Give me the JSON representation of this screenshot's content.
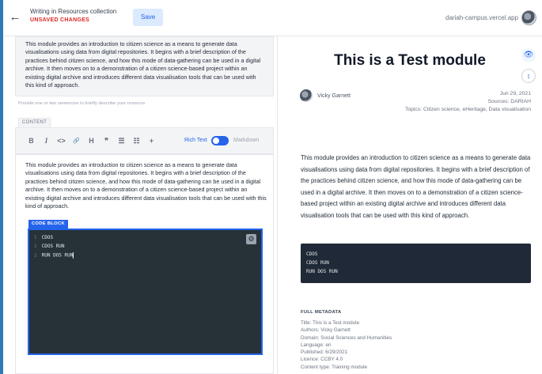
{
  "header": {
    "back_icon": "arrow-left-icon",
    "collection_title": "Writing in Resources collection",
    "status": "UNSAVED CHANGES",
    "save_label": "Save",
    "host": "dariah-campus.vercel.app",
    "status_color": "#dc2626"
  },
  "editor": {
    "summary_text": "This module provides an introduction to citizen science as a means to generate data visualisations using data from digital repositories. It begins with a brief description of the practices behind citizen science, and how this mode of data-gathering can be used in a digital archive. It then moves on to a demonstration of a citizen science-based project within an existing digital archive and introduces different data visualisation tools that can be used with this kind of approach.",
    "summary_hint": "Provide one or two sentences to briefly describe your resource",
    "content_label": "CONTENT",
    "toolbar": {
      "bold": "B",
      "italic": "I",
      "code": "<>",
      "link": "🔗",
      "heading": "H",
      "quote": "❞",
      "bullet_list": "☰",
      "numbered_list": "☷",
      "insert": "+"
    },
    "rich_text_label": "Rich Text",
    "markdown_label": "Markdown",
    "rich_text_enabled": true,
    "body_text": "This module provides an introduction to citizen science as a means to generate data visualisations using data from digital repositories. It begins with a brief description of the practices behind citizen science, and how this mode of data-gathering can be used in a digital archive. It then moves on to a demonstration of a citizen science-based project within an existing digital archive and introduces different data visualisation tools that can be used with this kind of approach.",
    "code_block_label": "CODE BLOCK",
    "code_lines": [
      {
        "n": "1",
        "text": "CDOS"
      },
      {
        "n": "2",
        "text": "CDOS RUN"
      },
      {
        "n": "3",
        "text": "RUN DOS RUN"
      }
    ]
  },
  "preview": {
    "title": "This is a Test module",
    "author": "Vicky Garnett",
    "date": "Jun 29, 2021",
    "sources": "Sources: DARIAH",
    "topics": "Topics: Citizen science, eHeritage, Data visualisation",
    "body_text": "This module provides an introduction to citizen science as a means to generate data visualisations using data from digital repositories. It begins with a brief description of the practices behind citizen science, and how this mode of data-gathering can be used in a digital archive. It then moves on to a demonstration of a citizen science-based project within an existing digital archive and introduces different data visualisation tools that can be used with this kind of approach.",
    "code_lines": [
      "CDOS",
      "CDOS RUN",
      "RUN DOS RUN"
    ],
    "full_metadata_heading": "FULL METADATA",
    "full_metadata": [
      "Title: This is a Test module",
      "Authors: Vicky Garnett",
      "Domain: Social Sciences and Humanities",
      "Language: en",
      "Published: 6/29/2021",
      "Licence: CCBY 4.0",
      "Content type: Training module"
    ]
  },
  "accent_color": "#2563eb"
}
